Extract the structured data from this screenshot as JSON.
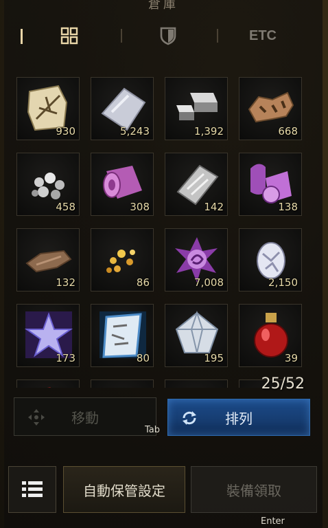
{
  "window": {
    "title": "倉庫"
  },
  "tabs": [
    {
      "name": "all",
      "icon": "grid-icon",
      "active": true
    },
    {
      "name": "equipment",
      "icon": "shield-icon",
      "active": false
    },
    {
      "name": "etc",
      "label": "ETC",
      "active": false
    }
  ],
  "items": [
    {
      "icon": "scroll-map-icon",
      "count": "930"
    },
    {
      "icon": "cloth-sheet-icon",
      "count": "5,243"
    },
    {
      "icon": "iron-ingot-icon",
      "count": "1,392"
    },
    {
      "icon": "animal-hide-icon",
      "count": "668"
    },
    {
      "icon": "silver-ore-icon",
      "count": "458"
    },
    {
      "icon": "purple-fabric-roll-icon",
      "count": "308"
    },
    {
      "icon": "metal-plate-icon",
      "count": "142"
    },
    {
      "icon": "purple-silk-roll-icon",
      "count": "138"
    },
    {
      "icon": "leather-scrap-icon",
      "count": "132"
    },
    {
      "icon": "gold-nuggets-icon",
      "count": "86"
    },
    {
      "icon": "purple-crest-icon",
      "count": "7,008"
    },
    {
      "icon": "crystal-egg-icon",
      "count": "2,150"
    },
    {
      "icon": "purple-star-gem-icon",
      "count": "173"
    },
    {
      "icon": "blue-rune-scroll-icon",
      "count": "80"
    },
    {
      "icon": "diamond-gem-icon",
      "count": "195"
    },
    {
      "icon": "red-potion-icon",
      "count": "39"
    }
  ],
  "capacity": "25/52",
  "buttons": {
    "move": "移動",
    "sort": "排列",
    "sort_hint": "Tab",
    "auto_storage": "自動保管設定",
    "equip_receive": "裝備領取",
    "equip_hint": "Enter"
  },
  "colors": {
    "count_text": "#e6d9a8",
    "sort_button": "#1c4b8a",
    "active_tab": "#e9d6a8"
  }
}
